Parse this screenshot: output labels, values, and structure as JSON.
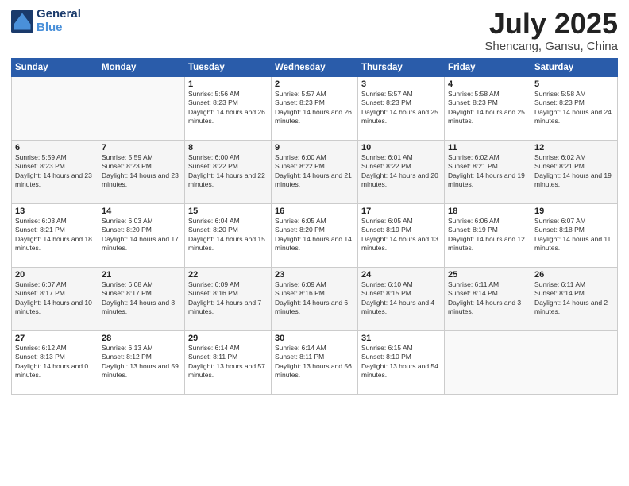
{
  "logo": {
    "line1": "General",
    "line2": "Blue"
  },
  "title": "July 2025",
  "location": "Shencang, Gansu, China",
  "days_of_week": [
    "Sunday",
    "Monday",
    "Tuesday",
    "Wednesday",
    "Thursday",
    "Friday",
    "Saturday"
  ],
  "weeks": [
    [
      {
        "day": "",
        "info": ""
      },
      {
        "day": "",
        "info": ""
      },
      {
        "day": "1",
        "info": "Sunrise: 5:56 AM\nSunset: 8:23 PM\nDaylight: 14 hours and 26 minutes."
      },
      {
        "day": "2",
        "info": "Sunrise: 5:57 AM\nSunset: 8:23 PM\nDaylight: 14 hours and 26 minutes."
      },
      {
        "day": "3",
        "info": "Sunrise: 5:57 AM\nSunset: 8:23 PM\nDaylight: 14 hours and 25 minutes."
      },
      {
        "day": "4",
        "info": "Sunrise: 5:58 AM\nSunset: 8:23 PM\nDaylight: 14 hours and 25 minutes."
      },
      {
        "day": "5",
        "info": "Sunrise: 5:58 AM\nSunset: 8:23 PM\nDaylight: 14 hours and 24 minutes."
      }
    ],
    [
      {
        "day": "6",
        "info": "Sunrise: 5:59 AM\nSunset: 8:23 PM\nDaylight: 14 hours and 23 minutes."
      },
      {
        "day": "7",
        "info": "Sunrise: 5:59 AM\nSunset: 8:23 PM\nDaylight: 14 hours and 23 minutes."
      },
      {
        "day": "8",
        "info": "Sunrise: 6:00 AM\nSunset: 8:22 PM\nDaylight: 14 hours and 22 minutes."
      },
      {
        "day": "9",
        "info": "Sunrise: 6:00 AM\nSunset: 8:22 PM\nDaylight: 14 hours and 21 minutes."
      },
      {
        "day": "10",
        "info": "Sunrise: 6:01 AM\nSunset: 8:22 PM\nDaylight: 14 hours and 20 minutes."
      },
      {
        "day": "11",
        "info": "Sunrise: 6:02 AM\nSunset: 8:21 PM\nDaylight: 14 hours and 19 minutes."
      },
      {
        "day": "12",
        "info": "Sunrise: 6:02 AM\nSunset: 8:21 PM\nDaylight: 14 hours and 19 minutes."
      }
    ],
    [
      {
        "day": "13",
        "info": "Sunrise: 6:03 AM\nSunset: 8:21 PM\nDaylight: 14 hours and 18 minutes."
      },
      {
        "day": "14",
        "info": "Sunrise: 6:03 AM\nSunset: 8:20 PM\nDaylight: 14 hours and 17 minutes."
      },
      {
        "day": "15",
        "info": "Sunrise: 6:04 AM\nSunset: 8:20 PM\nDaylight: 14 hours and 15 minutes."
      },
      {
        "day": "16",
        "info": "Sunrise: 6:05 AM\nSunset: 8:20 PM\nDaylight: 14 hours and 14 minutes."
      },
      {
        "day": "17",
        "info": "Sunrise: 6:05 AM\nSunset: 8:19 PM\nDaylight: 14 hours and 13 minutes."
      },
      {
        "day": "18",
        "info": "Sunrise: 6:06 AM\nSunset: 8:19 PM\nDaylight: 14 hours and 12 minutes."
      },
      {
        "day": "19",
        "info": "Sunrise: 6:07 AM\nSunset: 8:18 PM\nDaylight: 14 hours and 11 minutes."
      }
    ],
    [
      {
        "day": "20",
        "info": "Sunrise: 6:07 AM\nSunset: 8:17 PM\nDaylight: 14 hours and 10 minutes."
      },
      {
        "day": "21",
        "info": "Sunrise: 6:08 AM\nSunset: 8:17 PM\nDaylight: 14 hours and 8 minutes."
      },
      {
        "day": "22",
        "info": "Sunrise: 6:09 AM\nSunset: 8:16 PM\nDaylight: 14 hours and 7 minutes."
      },
      {
        "day": "23",
        "info": "Sunrise: 6:09 AM\nSunset: 8:16 PM\nDaylight: 14 hours and 6 minutes."
      },
      {
        "day": "24",
        "info": "Sunrise: 6:10 AM\nSunset: 8:15 PM\nDaylight: 14 hours and 4 minutes."
      },
      {
        "day": "25",
        "info": "Sunrise: 6:11 AM\nSunset: 8:14 PM\nDaylight: 14 hours and 3 minutes."
      },
      {
        "day": "26",
        "info": "Sunrise: 6:11 AM\nSunset: 8:14 PM\nDaylight: 14 hours and 2 minutes."
      }
    ],
    [
      {
        "day": "27",
        "info": "Sunrise: 6:12 AM\nSunset: 8:13 PM\nDaylight: 14 hours and 0 minutes."
      },
      {
        "day": "28",
        "info": "Sunrise: 6:13 AM\nSunset: 8:12 PM\nDaylight: 13 hours and 59 minutes."
      },
      {
        "day": "29",
        "info": "Sunrise: 6:14 AM\nSunset: 8:11 PM\nDaylight: 13 hours and 57 minutes."
      },
      {
        "day": "30",
        "info": "Sunrise: 6:14 AM\nSunset: 8:11 PM\nDaylight: 13 hours and 56 minutes."
      },
      {
        "day": "31",
        "info": "Sunrise: 6:15 AM\nSunset: 8:10 PM\nDaylight: 13 hours and 54 minutes."
      },
      {
        "day": "",
        "info": ""
      },
      {
        "day": "",
        "info": ""
      }
    ]
  ]
}
